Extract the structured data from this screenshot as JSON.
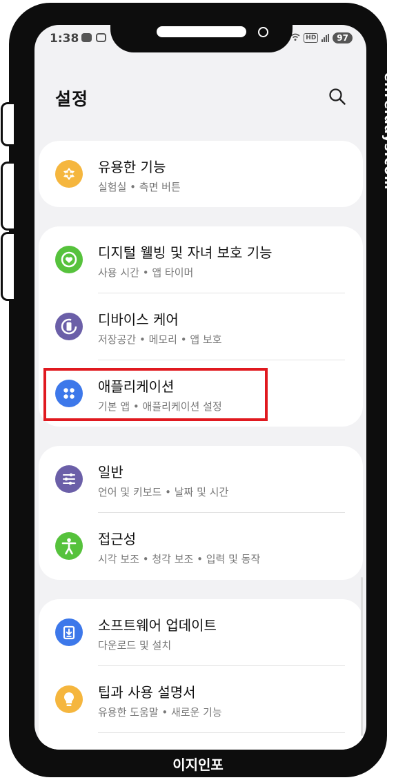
{
  "status_bar": {
    "time": "1:38",
    "hd": "HD",
    "battery": "97"
  },
  "header": {
    "title": "설정"
  },
  "sections": [
    {
      "items": [
        {
          "label": "유용한 기능",
          "sub": "실험실 • 측면 버튼",
          "icon": "plus-badge-icon",
          "color": "#f5b63e"
        }
      ]
    },
    {
      "items": [
        {
          "label": "디지털 웰빙 및 자녀 보호 기능",
          "sub": "사용 시간 • 앱 타이머",
          "icon": "heart-ring-icon",
          "color": "#56c23c"
        },
        {
          "label": "디바이스 케어",
          "sub": "저장공간 • 메모리 • 앱 보호",
          "icon": "device-care-icon",
          "color": "#6b5fa8"
        },
        {
          "label": "애플리케이션",
          "sub": "기본 앱 • 애플리케이션 설정",
          "icon": "apps-grid-icon",
          "color": "#3d78ea"
        }
      ]
    },
    {
      "items": [
        {
          "label": "일반",
          "sub": "언어 및 키보드 • 날짜 및 시간",
          "icon": "sliders-icon",
          "color": "#6b5fa8"
        },
        {
          "label": "접근성",
          "sub": "시각 보조 • 청각 보조 • 입력 및 동작",
          "icon": "accessibility-icon",
          "color": "#56c23c"
        }
      ]
    },
    {
      "items": [
        {
          "label": "소프트웨어 업데이트",
          "sub": "다운로드 및 설치",
          "icon": "download-icon",
          "color": "#3d78ea"
        },
        {
          "label": "팁과 사용 설명서",
          "sub": "유용한 도움말 • 새로운 기능",
          "icon": "lightbulb-icon",
          "color": "#f5b63e"
        }
      ]
    }
  ],
  "watermark": "ei.reidays.com",
  "footer": "이지인포",
  "highlight_color": "#e0191f"
}
